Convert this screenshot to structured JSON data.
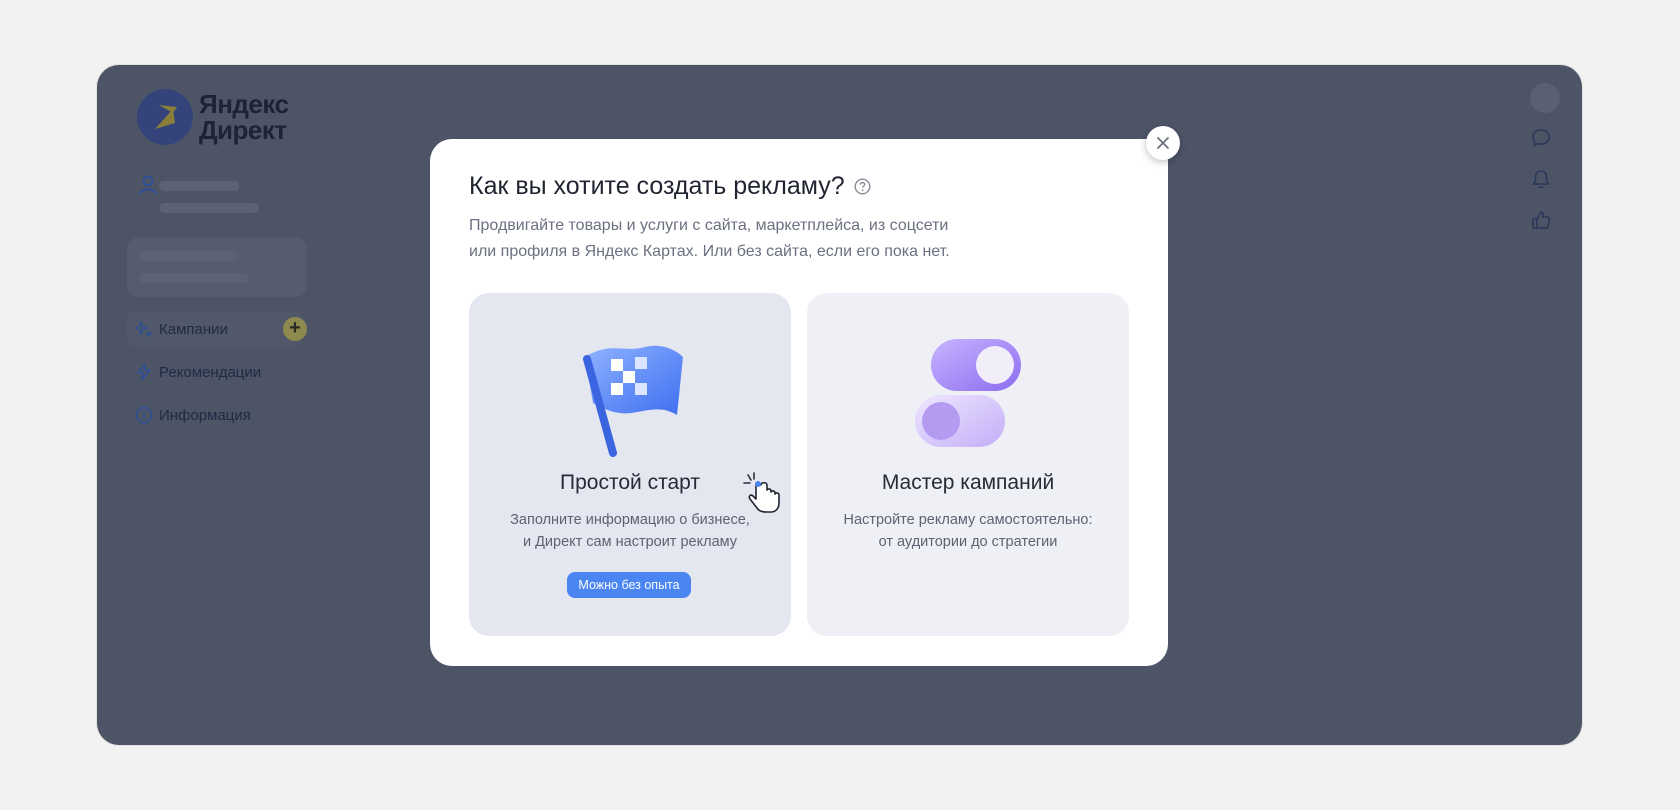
{
  "app": {
    "logo_line1": "Яндекс",
    "logo_line2": "Директ"
  },
  "sidebar": {
    "items": [
      {
        "label": "Кампании",
        "icon": "sparkle-icon",
        "active": true
      },
      {
        "label": "Рекомендации",
        "icon": "lightning-icon"
      },
      {
        "label": "Информация",
        "icon": "info-icon"
      }
    ],
    "add_label": "+"
  },
  "modal": {
    "title": "Как вы хотите создать рекламу?",
    "subtitle_line1": "Продвигайте товары и услуги с сайта, маркетплейса, из соцсети",
    "subtitle_line2": "или профиля в Яндекс Картах. Или без сайта, если его пока нет.",
    "close_label": "×",
    "cards": [
      {
        "title": "Простой старт",
        "desc_line1": "Заполните информацию о бизнесе,",
        "desc_line2": "и Директ сам настроит рекламу",
        "badge": "Можно без опыта",
        "illustration": "flag-icon"
      },
      {
        "title": "Мастер кампаний",
        "desc_line1": "Настройте рекламу самостоятельно:",
        "desc_line2": "от аудитории до стратегии",
        "illustration": "toggle-switches-icon"
      }
    ]
  },
  "colors": {
    "overlay": "#4d5466",
    "accent": "#4a85f2",
    "modal_bg": "#ffffff"
  }
}
